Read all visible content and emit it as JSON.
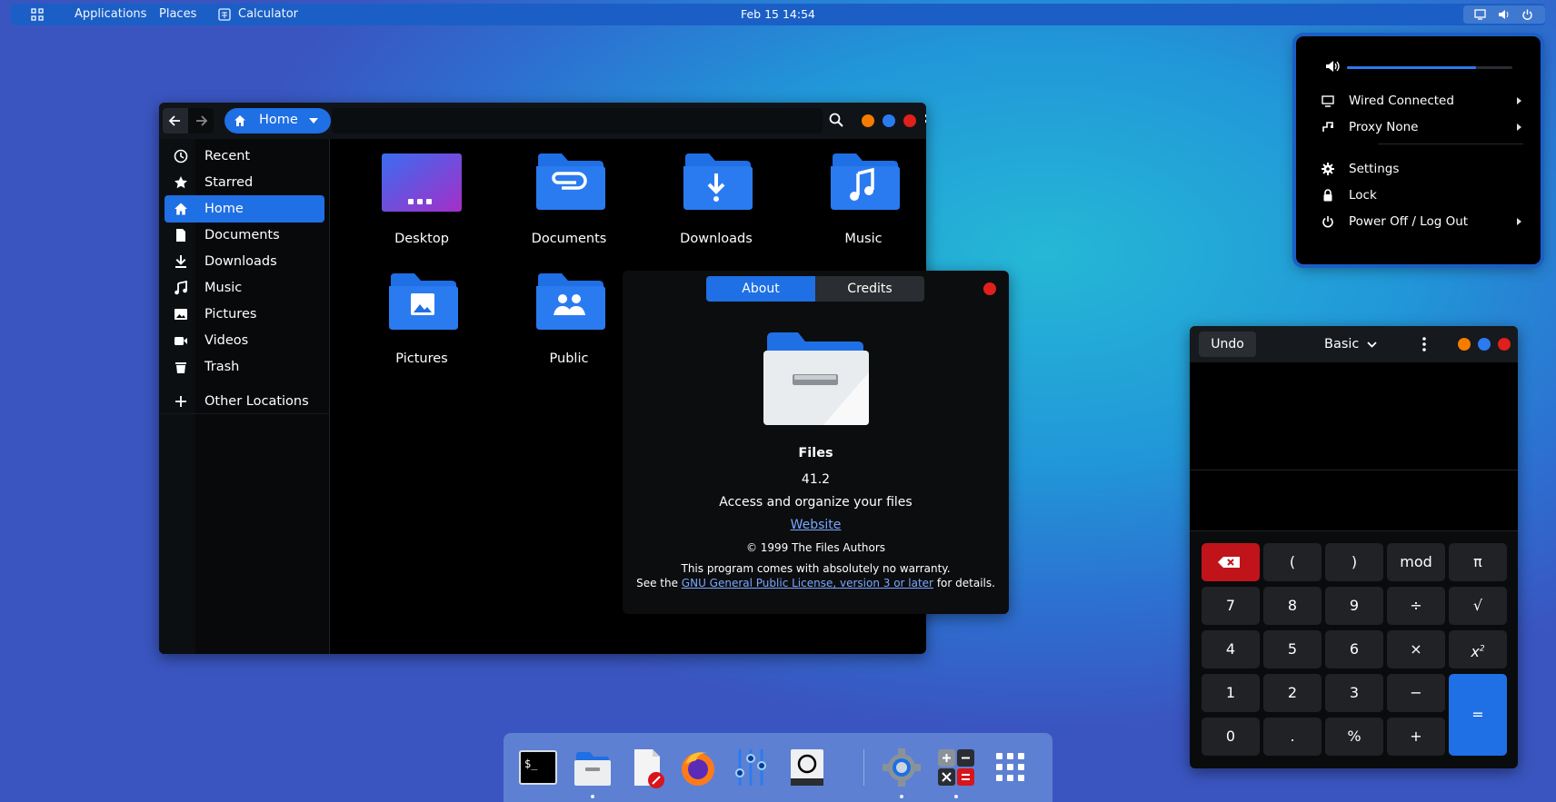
{
  "topbar": {
    "apps_label": "Applications",
    "places_label": "Places",
    "active_app": "Calculator",
    "clock": "Feb 15  14:54"
  },
  "files": {
    "location": "Home",
    "sidebar": [
      {
        "label": "Recent",
        "icon": "clock-icon"
      },
      {
        "label": "Starred",
        "icon": "star-icon"
      },
      {
        "label": "Home",
        "icon": "home-icon",
        "active": true
      },
      {
        "label": "Documents",
        "icon": "document-icon"
      },
      {
        "label": "Downloads",
        "icon": "download-icon"
      },
      {
        "label": "Music",
        "icon": "music-icon"
      },
      {
        "label": "Pictures",
        "icon": "picture-icon"
      },
      {
        "label": "Videos",
        "icon": "video-icon"
      },
      {
        "label": "Trash",
        "icon": "trash-icon"
      },
      {
        "label": "Other Locations",
        "icon": "plus-icon"
      }
    ],
    "folders": [
      {
        "label": "Desktop",
        "icon": "desktop-folder-icon"
      },
      {
        "label": "Documents",
        "icon": "documents-folder-icon"
      },
      {
        "label": "Downloads",
        "icon": "downloads-folder-icon"
      },
      {
        "label": "Music",
        "icon": "music-folder-icon"
      },
      {
        "label": "Pictures",
        "icon": "pictures-folder-icon"
      },
      {
        "label": "Public",
        "icon": "public-folder-icon"
      }
    ]
  },
  "about": {
    "tabs": [
      "About",
      "Credits"
    ],
    "app_name": "Files",
    "version": "41.2",
    "description": "Access and organize your files",
    "website": "Website",
    "copyright": "© 1999 The Files Authors",
    "warranty": "This program comes with absolutely no warranty.",
    "license_prefix": "See the ",
    "license_link": "GNU General Public License, version 3 or later",
    "license_suffix": " for details."
  },
  "calc": {
    "undo": "Undo",
    "mode": "Basic",
    "keys": [
      [
        "⌫",
        "(",
        ")",
        "mod",
        "π"
      ],
      [
        "7",
        "8",
        "9",
        "÷",
        "√"
      ],
      [
        "4",
        "5",
        "6",
        "×",
        "x²"
      ],
      [
        "1",
        "2",
        "3",
        "−",
        "="
      ],
      [
        "0",
        ".",
        "%",
        "+"
      ]
    ]
  },
  "menu": {
    "volume": 0.78,
    "items": [
      {
        "label": "Wired Connected",
        "icon": "network-icon",
        "arrow": true
      },
      {
        "label": "Proxy None",
        "icon": "proxy-icon",
        "arrow": true
      },
      {
        "label": "Settings",
        "icon": "gear-icon",
        "arrow": false
      },
      {
        "label": "Lock",
        "icon": "lock-icon",
        "arrow": false
      },
      {
        "label": "Power Off / Log Out",
        "icon": "power-icon",
        "arrow": true
      }
    ]
  },
  "dock": [
    "terminal-icon",
    "files-icon",
    "text-editor-icon",
    "firefox-icon",
    "mixer-icon",
    "screenshot-icon",
    "settings-icon",
    "calculator-icon",
    "app-grid-icon"
  ],
  "colors": {
    "accent": "#1f6fe5",
    "close": "#e0201b",
    "minimize": "#f57c00",
    "maximize": "#2b7bf0",
    "backspace": "#c0141a"
  }
}
